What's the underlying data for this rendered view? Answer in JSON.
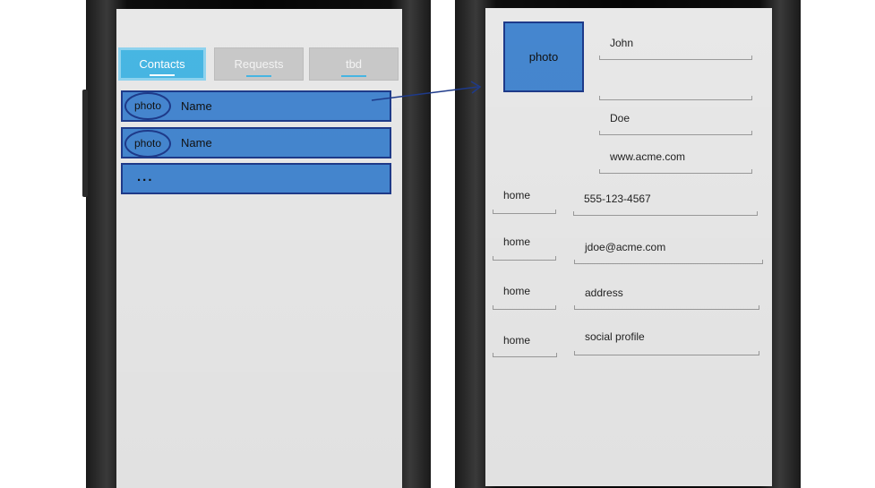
{
  "contacts_screen": {
    "tabs": [
      {
        "label": "Contacts"
      },
      {
        "label": "Requests"
      },
      {
        "label": "tbd"
      }
    ],
    "rows": [
      {
        "photo": "photo",
        "name": "Name"
      },
      {
        "photo": "photo",
        "name": "Name"
      }
    ],
    "more": "..."
  },
  "detail_screen": {
    "photo": "photo",
    "first_name": "John",
    "middle_name": "",
    "last_name": "Doe",
    "website": "www.acme.com",
    "phone": {
      "type": "home",
      "value": "555-123-4567"
    },
    "email": {
      "type": "home",
      "value": "jdoe@acme.com"
    },
    "address": {
      "type": "home",
      "value": "address"
    },
    "social": {
      "type": "home",
      "value": "social profile"
    }
  },
  "colors": {
    "accent": "#47b6e3",
    "row_fill": "#4586cf",
    "row_border": "#1e3a8a",
    "arrow": "#1e3a8a",
    "screen_bg": "#e8e8e8"
  }
}
